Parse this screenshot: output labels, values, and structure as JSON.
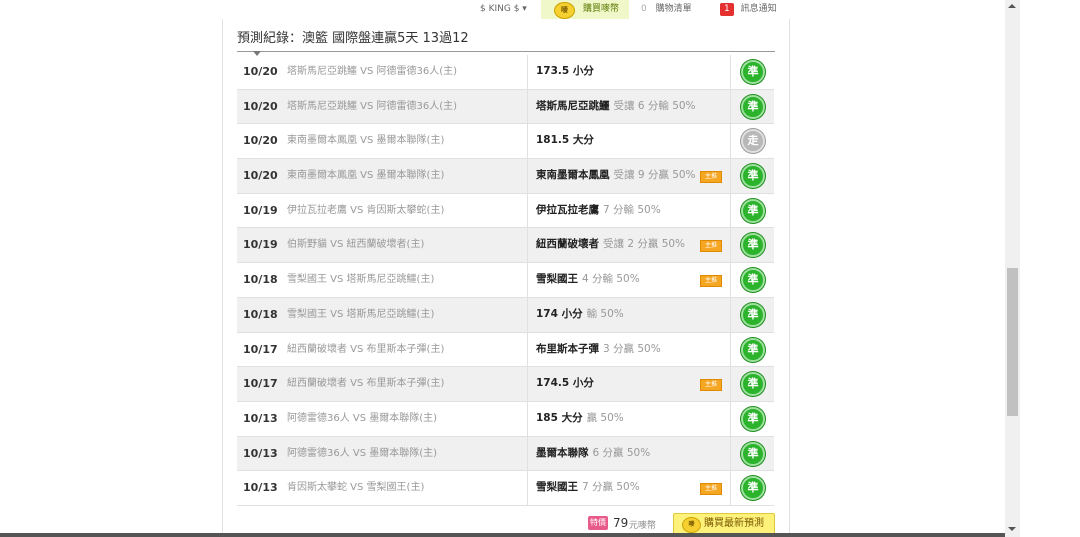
{
  "topbar": {
    "user_label": "$ KING $ ▾",
    "buy_coin_icon": "coin-icon",
    "buy_label": "購買嘜幣",
    "cart_count": "0",
    "cart_label": "購物清單",
    "notify_count": "1",
    "notify_label": "訊息通知"
  },
  "record": {
    "title": "預測紀錄：澳籃 國際盤連贏5天 13過12"
  },
  "rows": [
    {
      "date": "10/20",
      "match": "塔斯馬尼亞跳鱷 VS 阿德雷德36人(主)",
      "pick": "173.5 小分",
      "detail": "",
      "tag": "",
      "result": "準"
    },
    {
      "date": "10/20",
      "match": "塔斯馬尼亞跳鱷 VS 阿德雷德36人(主)",
      "pick": "塔斯馬尼亞跳鱷",
      "detail": "受讓 6 分輸 50%",
      "tag": "",
      "result": "準"
    },
    {
      "date": "10/20",
      "match": "東南墨爾本鳳凰 VS 墨爾本聯隊(主)",
      "pick": "181.5 大分",
      "detail": "",
      "tag": "",
      "result": "走"
    },
    {
      "date": "10/20",
      "match": "東南墨爾本鳳凰 VS 墨爾本聯隊(主)",
      "pick": "東南墨爾本鳳凰",
      "detail": "受讓 9 分贏 50%",
      "tag": "主推",
      "result": "準"
    },
    {
      "date": "10/19",
      "match": "伊拉瓦拉老鷹 VS 肯因斯太攀蛇(主)",
      "pick": "伊拉瓦拉老鷹",
      "detail": "7 分輸 50%",
      "tag": "",
      "result": "準"
    },
    {
      "date": "10/19",
      "match": "伯斯野貓 VS 紐西蘭破壞者(主)",
      "pick": "紐西蘭破壞者",
      "detail": "受讓 2 分贏 50%",
      "tag": "主推",
      "result": "準"
    },
    {
      "date": "10/18",
      "match": "雪梨國王 VS 塔斯馬尼亞跳鱷(主)",
      "pick": "雪梨國王",
      "detail": "4 分輸 50%",
      "tag": "主推",
      "result": "準"
    },
    {
      "date": "10/18",
      "match": "雪梨國王 VS 塔斯馬尼亞跳鱷(主)",
      "pick": "174 小分",
      "detail": "輸 50%",
      "tag": "",
      "result": "準"
    },
    {
      "date": "10/17",
      "match": "紐西蘭破壞者 VS 布里斯本子彈(主)",
      "pick": "布里斯本子彈",
      "detail": "3 分贏 50%",
      "tag": "",
      "result": "準"
    },
    {
      "date": "10/17",
      "match": "紐西蘭破壞者 VS 布里斯本子彈(主)",
      "pick": "174.5 小分",
      "detail": "",
      "tag": "主推",
      "result": "準"
    },
    {
      "date": "10/13",
      "match": "阿德雷德36人 VS 墨爾本聯隊(主)",
      "pick": "185 大分",
      "detail": "贏 50%",
      "tag": "",
      "result": "準"
    },
    {
      "date": "10/13",
      "match": "阿德雷德36人 VS 墨爾本聯隊(主)",
      "pick": "墨爾本聯隊",
      "detail": "6 分贏 50%",
      "tag": "",
      "result": "準"
    },
    {
      "date": "10/13",
      "match": "肯因斯太攀蛇 VS 雪梨國王(主)",
      "pick": "雪梨國王",
      "detail": "7 分贏 50%",
      "tag": "主推",
      "result": "準"
    }
  ],
  "purchase": {
    "price_tag": "特價",
    "price": "79",
    "price_unit": "元嘜幣",
    "buy_button_label": "購買最新預測"
  }
}
